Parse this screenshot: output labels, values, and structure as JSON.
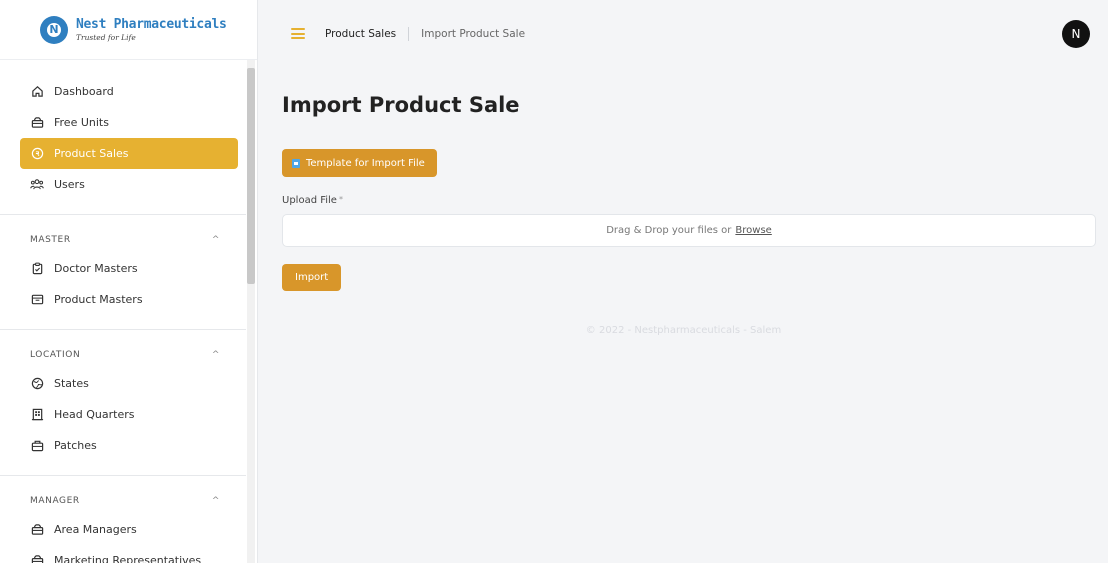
{
  "brand": {
    "name": "Nest Pharmaceuticals",
    "tagline": "Trusted for Life",
    "logo_letter": "N",
    "color": "#2f7fc0"
  },
  "sidebar": {
    "items": [
      {
        "label": "Dashboard",
        "icon": "home-icon"
      },
      {
        "label": "Free Units",
        "icon": "briefcase-icon"
      },
      {
        "label": "Product Sales",
        "icon": "coin-icon",
        "active": true
      },
      {
        "label": "Users",
        "icon": "users-icon"
      }
    ],
    "sections": [
      {
        "title": "MASTER",
        "items": [
          {
            "label": "Doctor Masters",
            "icon": "clipboard-icon"
          },
          {
            "label": "Product Masters",
            "icon": "table-icon"
          }
        ]
      },
      {
        "title": "LOCATION",
        "items": [
          {
            "label": "States",
            "icon": "globe-icon"
          },
          {
            "label": "Head Quarters",
            "icon": "building-icon"
          },
          {
            "label": "Patches",
            "icon": "briefcase-icon"
          }
        ]
      },
      {
        "title": "MANAGER",
        "items": [
          {
            "label": "Area Managers",
            "icon": "briefcase-icon"
          },
          {
            "label": "Marketing Representatives",
            "icon": "briefcase-icon"
          }
        ]
      }
    ]
  },
  "topbar": {
    "breadcrumb": [
      "Product Sales",
      "Import Product Sale"
    ],
    "avatar_initial": "N"
  },
  "main": {
    "title": "Import Product Sale",
    "template_button": "Template for Import File",
    "upload_label": "Upload File",
    "required_mark": "*",
    "dropzone_text": "Drag & Drop your files or",
    "browse_text": "Browse",
    "import_button": "Import"
  },
  "footer": "© 2022 - Nestpharmaceuticals - Salem",
  "colors": {
    "accent": "#e6b131",
    "button": "#d8962a",
    "avatar_bg": "#111111"
  }
}
